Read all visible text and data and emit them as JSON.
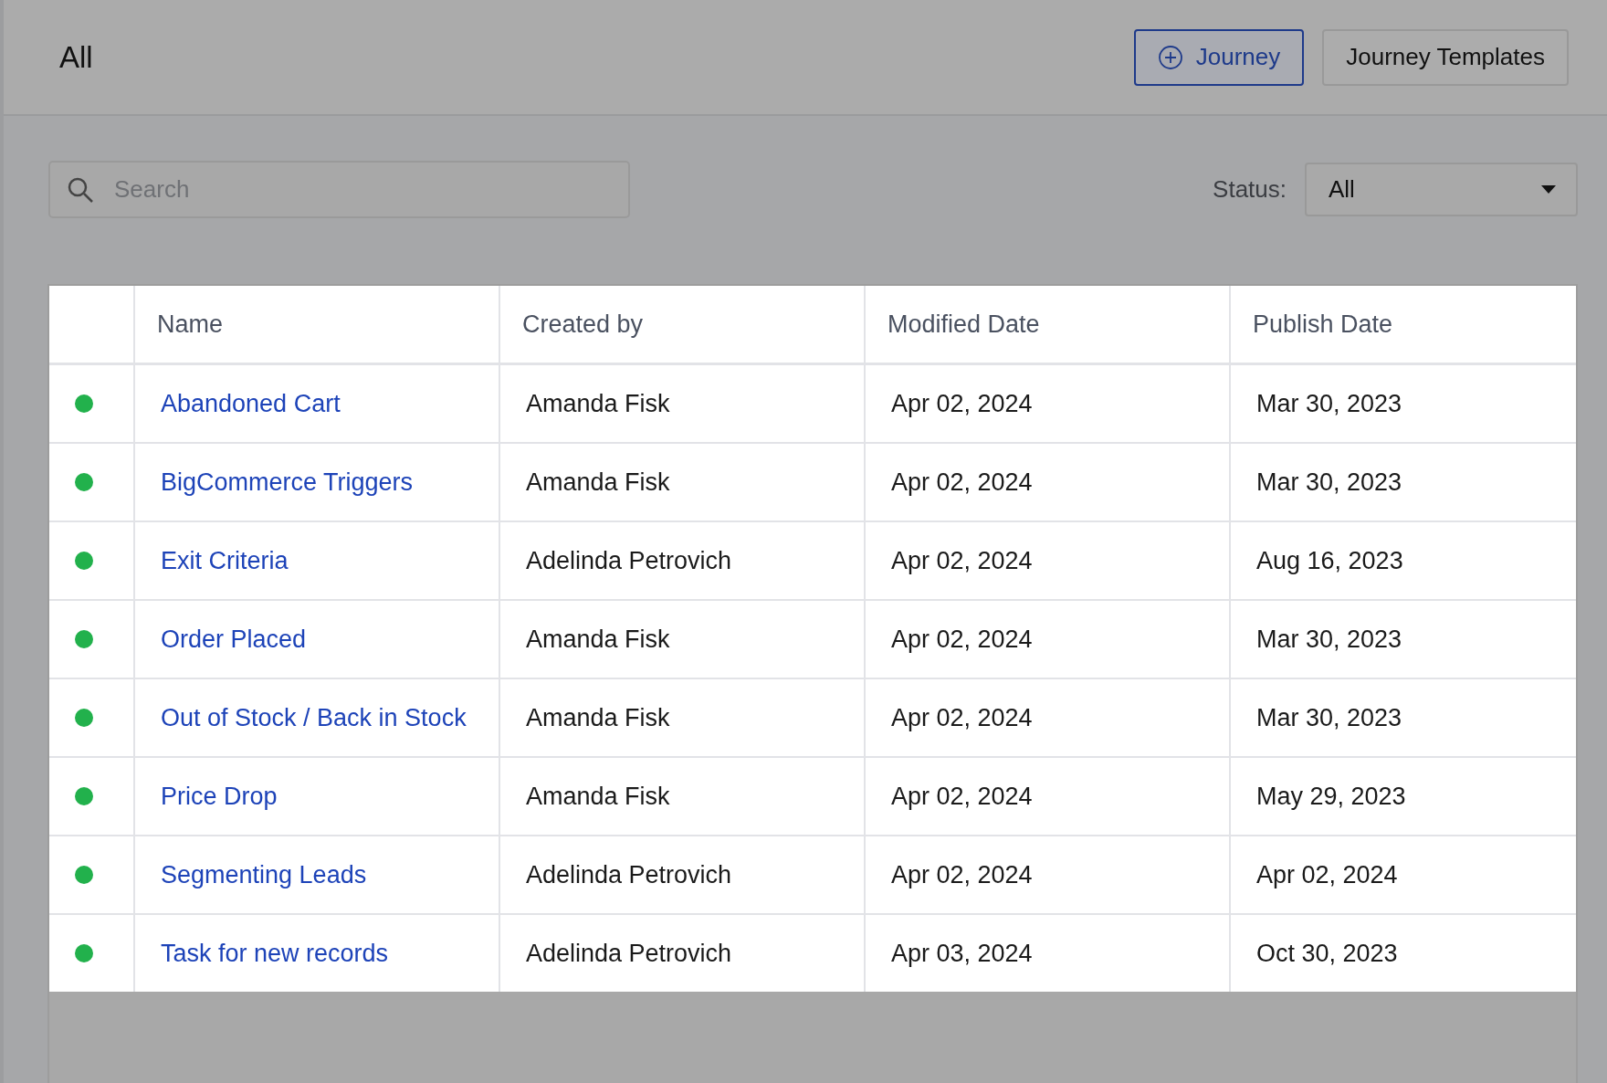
{
  "header": {
    "title": "All",
    "buttons": [
      {
        "kind": "primary",
        "label": "Journey"
      },
      {
        "kind": "secondary",
        "label": "Journey Templates"
      }
    ]
  },
  "toolbar": {
    "search": {
      "placeholder": "Search"
    },
    "status_label": "Status:",
    "status_value": "All"
  },
  "table": {
    "columns": [
      "Name",
      "Created by",
      "Modified Date",
      "Publish Date"
    ],
    "rows": [
      {
        "color": "#22b14c",
        "name": "Abandoned Cart",
        "created_by": "Amanda Fisk",
        "modified": "Apr 02, 2024",
        "published": "Mar 30, 2023"
      },
      {
        "color": "#22b14c",
        "name": "BigCommerce Triggers",
        "created_by": "Amanda Fisk",
        "modified": "Apr 02, 2024",
        "published": "Mar 30, 2023"
      },
      {
        "color": "#22b14c",
        "name": "Exit Criteria",
        "created_by": "Adelinda Petrovich",
        "modified": "Apr 02, 2024",
        "published": "Aug 16, 2023"
      },
      {
        "color": "#22b14c",
        "name": "Order Placed",
        "created_by": "Amanda Fisk",
        "modified": "Apr 02, 2024",
        "published": "Mar 30, 2023"
      },
      {
        "color": "#22b14c",
        "name": "Out of Stock / Back in Stock",
        "created_by": "Amanda Fisk",
        "modified": "Apr 02, 2024",
        "published": "Mar 30, 2023"
      },
      {
        "color": "#22b14c",
        "name": "Price Drop",
        "created_by": "Amanda Fisk",
        "modified": "Apr 02, 2024",
        "published": "May 29, 2023"
      },
      {
        "color": "#22b14c",
        "name": "Segmenting Leads",
        "created_by": "Adelinda Petrovich",
        "modified": "Apr 02, 2024",
        "published": "Apr 02, 2024"
      },
      {
        "color": "#22b14c",
        "name": "Task for new records",
        "created_by": "Adelinda Petrovich",
        "modified": "Apr 03, 2024",
        "published": "Oct 30, 2023"
      }
    ]
  }
}
